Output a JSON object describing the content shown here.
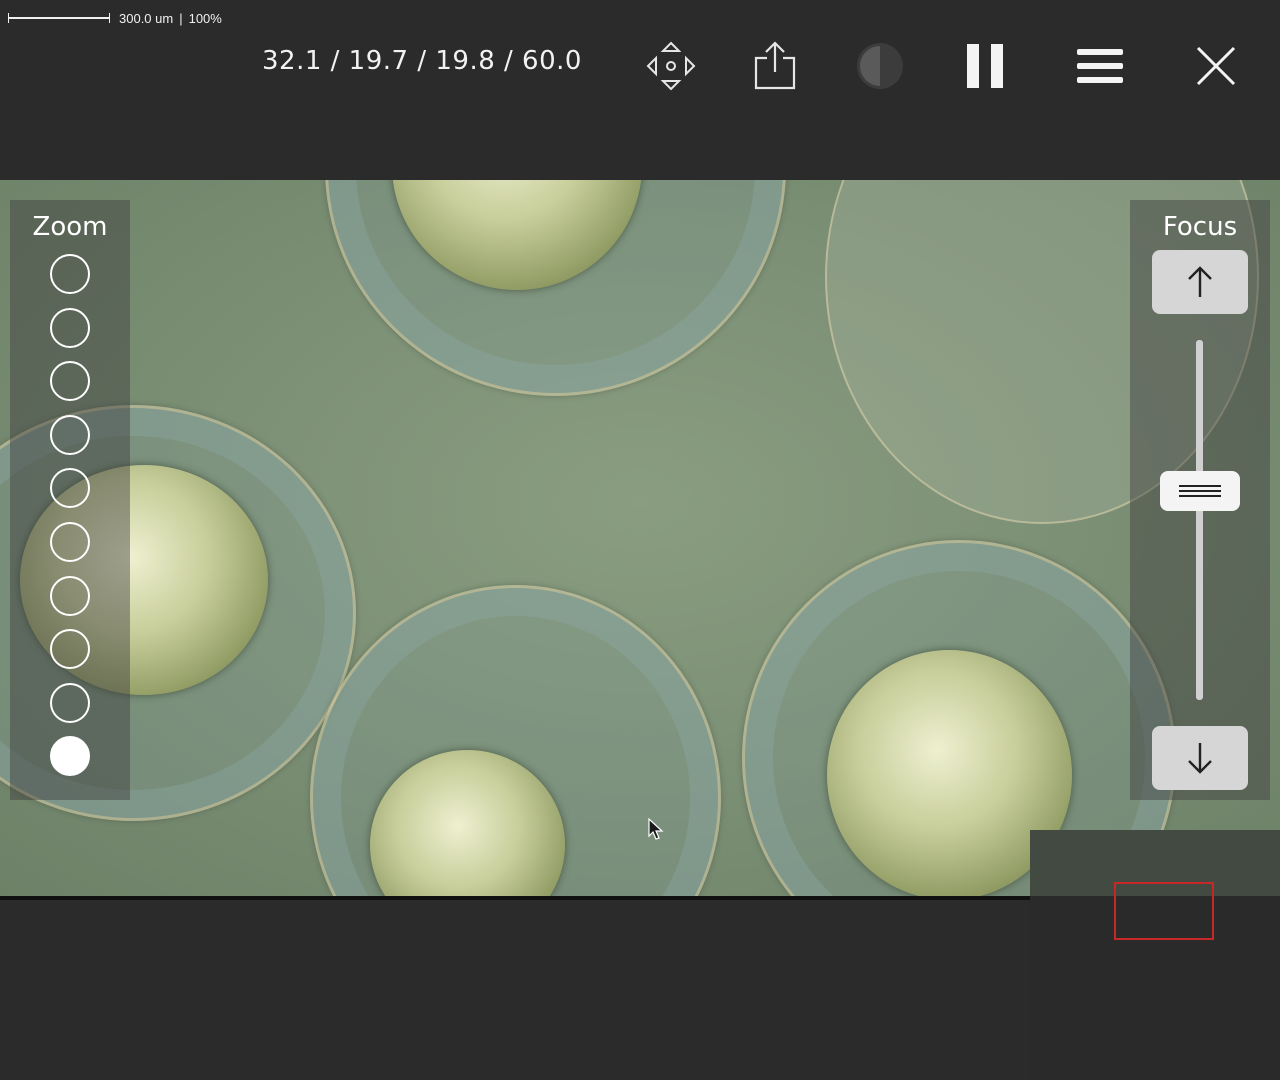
{
  "scale_bar": {
    "length_label": "300.0 um",
    "separator": "|",
    "zoom_percent": "100%"
  },
  "toolbar": {
    "coordinates": "32.1 / 19.7 / 19.8 / 60.0",
    "icons": [
      "move-icon",
      "share-icon",
      "contrast-icon",
      "pause-icon",
      "menu-icon",
      "close-icon"
    ]
  },
  "zoom_panel": {
    "title": "Zoom",
    "levels": 10,
    "selected_level": 10
  },
  "focus_panel": {
    "title": "Focus",
    "up_icon": "arrow-up-icon",
    "down_icon": "arrow-down-icon",
    "slider_position_fraction": 0.42
  },
  "colors": {
    "background": "#2b2b2b",
    "panel_overlay": "rgba(60,60,60,0.45)",
    "minimap_viewport": "#c62828",
    "focus_button": "#d6d6d6"
  }
}
